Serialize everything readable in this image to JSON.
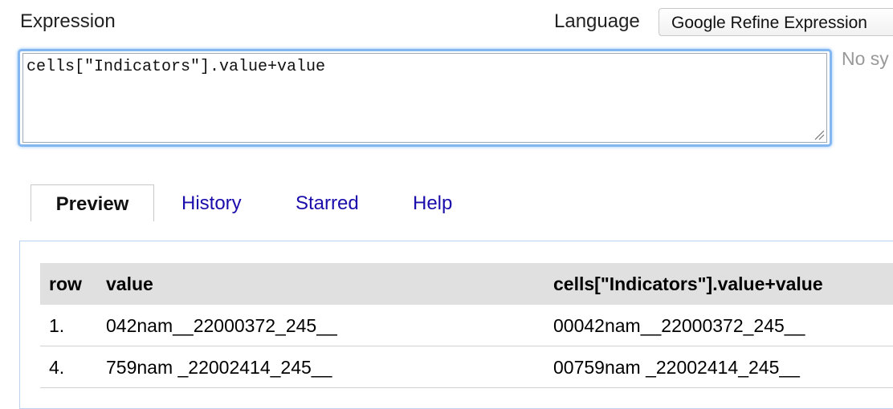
{
  "expression": {
    "label": "Expression",
    "value": "cells[\"Indicators\"].value+value",
    "syntax_status": "No sy"
  },
  "language": {
    "label": "Language",
    "selected": "Google Refine Expression"
  },
  "tabs": [
    {
      "label": "Preview",
      "active": true
    },
    {
      "label": "History",
      "active": false
    },
    {
      "label": "Starred",
      "active": false
    },
    {
      "label": "Help",
      "active": false
    }
  ],
  "preview_table": {
    "headers": {
      "row": "row",
      "value": "value",
      "result": "cells[\"Indicators\"].value+value"
    },
    "rows": [
      {
        "row": "1.",
        "value": "042nam__22000372_245__",
        "result": "00042nam__22000372_245__"
      },
      {
        "row": "4.",
        "value": "759nam _22002414_245__",
        "result": "00759nam _22002414_245__"
      }
    ]
  }
}
